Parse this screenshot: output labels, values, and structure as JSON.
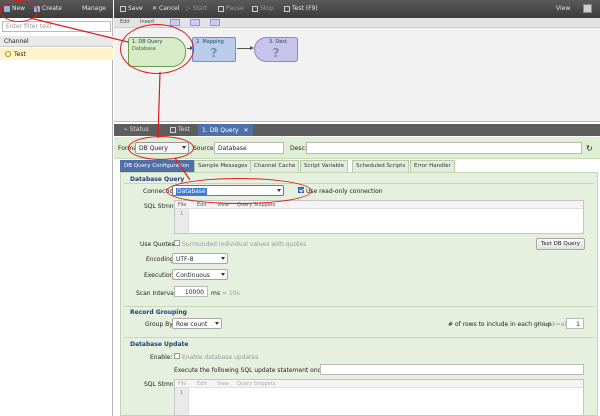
{
  "left_panel": {
    "toolbar": {
      "new_label": "New",
      "create_label": "Create",
      "manage_label": "Manage"
    },
    "filter_placeholder": "Enter filter text",
    "channel_header": "Channel",
    "channel_item": "Test"
  },
  "top_toolbar": {
    "save_label": "Save",
    "cancel_label": "Cancel",
    "start_label": "Start",
    "pause_label": "Pause",
    "stop_label": "Stop",
    "test_label": "Test (F9)",
    "view_label": "View"
  },
  "flow": {
    "bar": {
      "edit_label": "Edit",
      "insert_label": "Insert"
    },
    "nodes": [
      {
        "title": "1. DB Query",
        "subtitle": "Database"
      },
      {
        "title": "2. Mapping",
        "subtitle": "?"
      },
      {
        "title": "3. Dest.",
        "subtitle": "?"
      }
    ]
  },
  "bottom_tabs": {
    "status_label": "Status",
    "test_label": "Test",
    "active_label": "1. DB Query"
  },
  "form": {
    "format_label": "Format:",
    "format_value": "DB Query",
    "source_label": "Source:",
    "source_value": "Database",
    "desc_label": "Desc:",
    "desc_value": ""
  },
  "sub_tabs": [
    "DB Query Configuration",
    "Sample Messages",
    "Channel Cache",
    "Script Variable",
    "Scheduled Scripts",
    "Error Handler"
  ],
  "database_query": {
    "header": "Database Query",
    "connection_label": "Connection:",
    "connection_value": "Database",
    "readonly_label": "Use read-only connection",
    "readonly_checked": true,
    "sql_label": "SQL Stmnt:",
    "editor_menu": [
      "File",
      "Edit",
      "View",
      "Query Snippets"
    ],
    "line_number": "1",
    "use_quotes_label": "Use Quotes:",
    "use_quotes_option": "Surrounded individual values with quotes",
    "test_button": "Test DB Query",
    "encoding_label": "Encoding:",
    "encoding_value": "UTF-8",
    "execution_label": "Execution:",
    "execution_value": "Continuous",
    "scan_label": "Scan Interval:",
    "scan_value": "10000",
    "scan_unit": "ms",
    "scan_hint": "= 10s"
  },
  "record_grouping": {
    "header": "Record Grouping",
    "group_label": "Group By:",
    "group_value": "Row count",
    "rows_label": "# of rows to include in each group",
    "rows_hint": "(blank=all)",
    "rows_value": "1"
  },
  "database_update": {
    "header": "Database Update",
    "enable_label": "Enable:",
    "enable_option": "Enable database updates",
    "execute_label": "Execute the following SQL update statement once per:",
    "sql_label": "SQL Stmnt:",
    "editor_menu": [
      "File",
      "Edit",
      "View",
      "Query Snippets"
    ],
    "line_number": "1"
  },
  "colors": {
    "accent": "#4f6fa8",
    "annotation": "#e01c1c",
    "panel": "#e6f0de"
  }
}
